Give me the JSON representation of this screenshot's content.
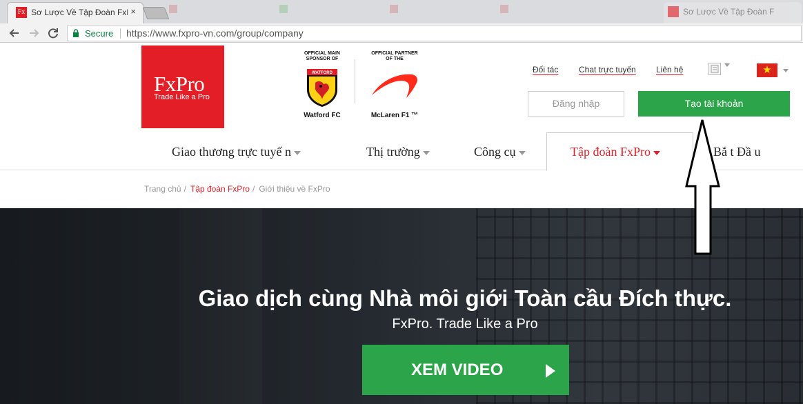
{
  "browser": {
    "active_tab_title": "Sơ Lược Về Tập Đoàn FxPr",
    "active_tab_favicon_text": "Fx",
    "close_glyph": "×",
    "background_tabs": [
      "",
      "",
      "",
      "",
      ""
    ],
    "faded_tab_title": "Sơ Lược Về Tập Đoàn F",
    "security_label": "Secure",
    "url": "https://www.fxpro-vn.com/group/company"
  },
  "header": {
    "logo": {
      "word": "FxPro",
      "tagline": "Trade Like a Pro"
    },
    "sponsor_main": {
      "caption_line1": "OFFICIAL MAIN",
      "caption_line2": "SPONSOR OF",
      "badge_text": "WATFORD",
      "name": "Watford FC"
    },
    "sponsor_partner": {
      "caption_line1": "OFFICIAL PARTNER",
      "caption_line2": "OF THE",
      "name": "McLaren F1 ™"
    },
    "top_links": {
      "partner": "Đối tác",
      "chat": "Chat trực tuyến",
      "contact": "Liên hệ"
    },
    "flag_star": "★",
    "login_label": "Đăng nhập",
    "create_account_label": "Tạo tài khoản"
  },
  "nav": {
    "items": [
      {
        "label": "Giao thương trực tuyế n"
      },
      {
        "label": "Thị trường"
      },
      {
        "label": "Công cụ"
      },
      {
        "label": "Tập đoàn FxPro"
      },
      {
        "label": "Bắ t Đầ u"
      }
    ],
    "active_index": 3
  },
  "breadcrumb": {
    "home": "Trang chủ",
    "group": "Tập đoàn FxPro",
    "current": "Giới thiệu về FxPro",
    "separator": "/"
  },
  "hero": {
    "title": "Giao dịch cùng Nhà môi giới Toàn cầu Đích thực.",
    "subtitle": "FxPro. Trade Like a Pro",
    "video_button": "XEM VIDEO"
  },
  "colors": {
    "brand_red": "#e41e26",
    "cta_green": "#2ca44a",
    "secure_green": "#0b8043"
  }
}
